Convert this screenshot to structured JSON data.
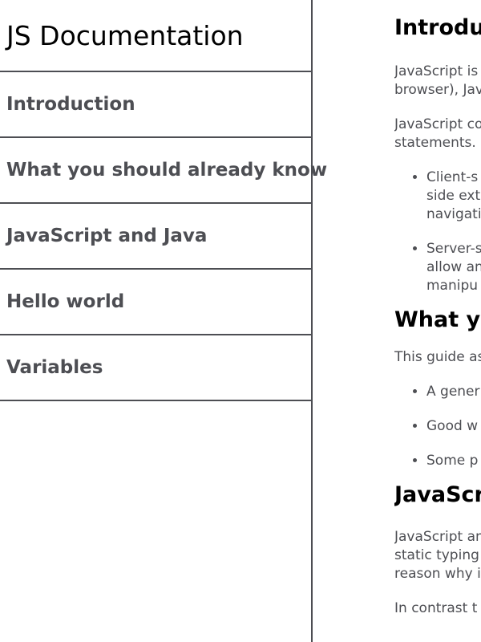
{
  "navbar": {
    "title": "JS Documentation",
    "items": [
      {
        "label": "Introduction"
      },
      {
        "label": "What you should already know"
      },
      {
        "label": "JavaScript and Java"
      },
      {
        "label": "Hello world"
      },
      {
        "label": "Variables"
      }
    ]
  },
  "main": {
    "sections": {
      "introduction": {
        "title": "Introduction",
        "p1_line1": "JavaScript is",
        "p1_line2": "browser), Jav",
        "p2_line1": "JavaScript co",
        "p2_line2": "statements.",
        "bullet1_line1": "Client-s",
        "bullet1_line2": "side ext",
        "bullet1_line3": "navigati",
        "bullet2_line1": "Server-s",
        "bullet2_line2": "allow an",
        "bullet2_line3": "manipu"
      },
      "what_you_should_know": {
        "title": "What yo",
        "p1": "This guide as",
        "bullet1": "A gener",
        "bullet2": "Good w",
        "bullet3": "Some p"
      },
      "javascript_and_java": {
        "title": "JavaScri",
        "p1_line1": "JavaScript an",
        "p1_line2": "static typing",
        "p1_line3": "reason why i",
        "p2_line1": "In contrast t"
      }
    }
  }
}
